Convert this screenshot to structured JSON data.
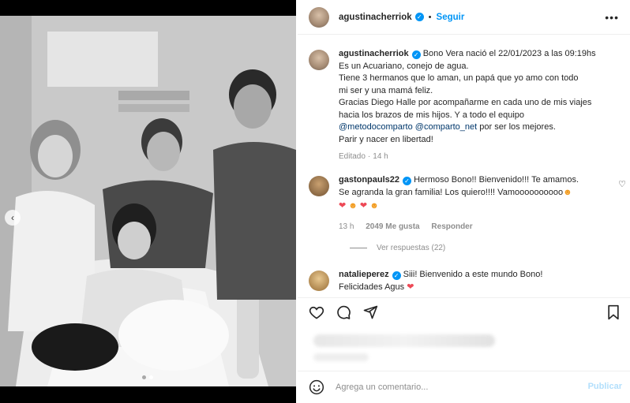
{
  "post": {
    "username": "agustinacherriok",
    "follow_label": "Seguir",
    "separator": "•",
    "more_label": "•••"
  },
  "caption": {
    "username": "agustinacherriok",
    "lines": [
      "Bono Vera nació el 22/01/2023 a las 09:19hs",
      "Es un Acuariano, conejo de agua.",
      "Tiene 3 hermanos que lo aman, un papá que yo amo con todo",
      "mi ser y una mamá feliz.",
      "Gracias Diego Halle por acompañarme en cada uno de mis viajes",
      "hacia los brazos de mis hijos. Y a todo el equipo"
    ],
    "mention1": "@metodocomparto",
    "mention2": "@comparto_net",
    "mention_tail": "por ser los mejores.",
    "last_line": "Parir y nacer en libertad!",
    "edited": "Editado",
    "edited_sep": "·",
    "time": "14 h"
  },
  "comments": [
    {
      "username": "gastonpauls22",
      "text_line1": "Hermoso Bono!! Bienvenido!!! Te amamos.",
      "text_line2": "Se agranda la gran familia! Los quiero!!!! Vamoooooooooo",
      "time": "13 h",
      "likes": "2049 Me gusta",
      "reply": "Responder",
      "view_replies": "Ver respuestas (22)"
    },
    {
      "username": "natalieperez",
      "text_line1": "Siii! Bienvenido a este mundo Bono!",
      "text_line2": "Felicidades Agus"
    }
  ],
  "comment_input": {
    "placeholder": "Agrega un comentario..."
  },
  "publish_label": "Publicar",
  "colors": {
    "accent": "#0095f6",
    "heart": "#ed4956",
    "muted": "#8e8e8e"
  }
}
